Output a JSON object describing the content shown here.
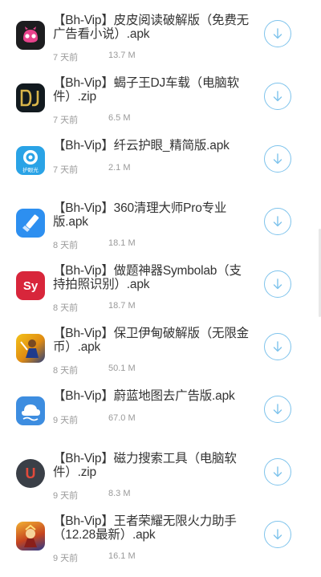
{
  "items": [
    {
      "title": "【Bh-Vip】皮皮阅读破解版（免费无广告看小说）.apk",
      "time": "7 天前",
      "size": "13.7 M",
      "icon": "pipi-reader-icon"
    },
    {
      "title": "【Bh-Vip】蝎子王DJ车载（电脑软件）.zip",
      "time": "7 天前",
      "size": "6.5 M",
      "icon": "dj-icon"
    },
    {
      "title": "【Bh-Vip】纤云护眼_精简版.apk",
      "time": "7 天前",
      "size": "2.1 M",
      "icon": "eye-care-icon",
      "icon_text": "护眼光"
    },
    {
      "title": "【Bh-Vip】360清理大师Pro专业版.apk",
      "time": "8 天前",
      "size": "18.1 M",
      "icon": "broom-icon"
    },
    {
      "title": "【Bh-Vip】做题神器Symbolab（支持拍照识别）.apk",
      "time": "8 天前",
      "size": "18.7 M",
      "icon": "symbolab-icon",
      "icon_text": "Sy"
    },
    {
      "title": "【Bh-Vip】保卫伊甸破解版（无限金币）.apk",
      "time": "8 天前",
      "size": "50.1 M",
      "icon": "game-hero-icon"
    },
    {
      "title": "【Bh-Vip】蔚蓝地图去广告版.apk",
      "time": "9 天前",
      "size": "67.0 M",
      "icon": "blue-map-icon"
    },
    {
      "title": "【Bh-Vip】磁力搜索工具（电脑软件）.zip",
      "time": "9 天前",
      "size": "8.3 M",
      "icon": "magnet-icon",
      "icon_text": "U"
    },
    {
      "title": "【Bh-Vip】王者荣耀无限火力助手（12.28最新）.apk",
      "time": "9 天前",
      "size": "16.1 M",
      "icon": "honor-of-kings-icon"
    }
  ],
  "colors": {
    "accent": "#7ec3ec",
    "title": "#333333",
    "meta": "#9a9a9a"
  }
}
